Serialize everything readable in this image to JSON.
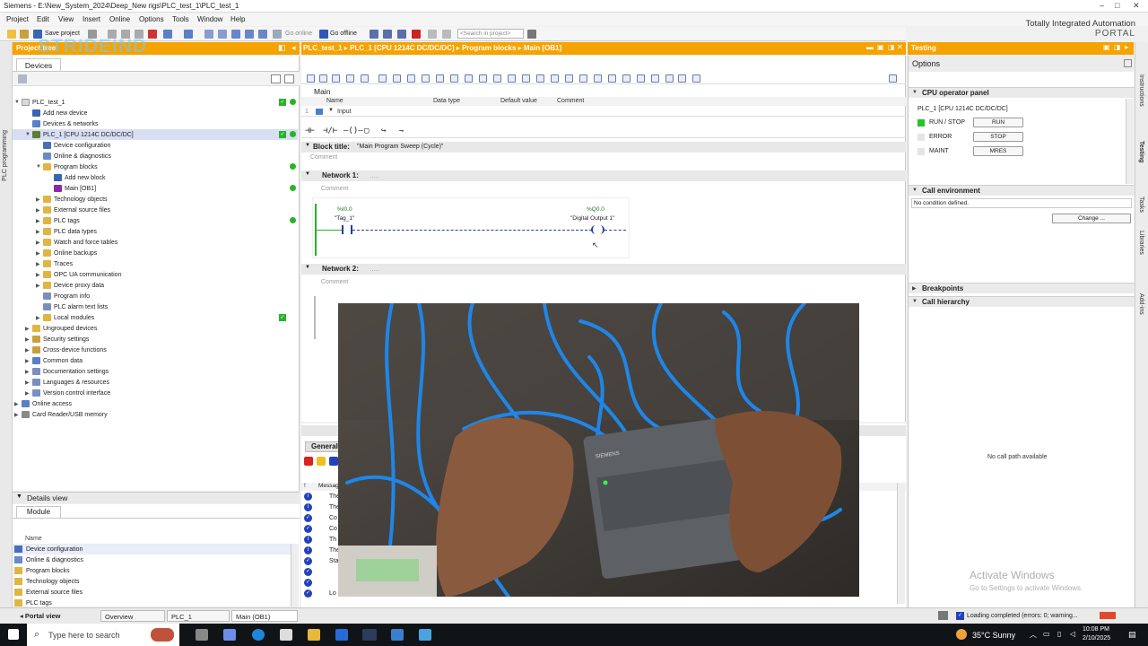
{
  "window": {
    "title": "Siemens - E:\\New_System_2024\\Deep_New rigs\\PLC_test_1\\PLC_test_1",
    "brand_line1": "Totally Integrated Automation",
    "brand_line2": "PORTAL"
  },
  "menu": [
    "Project",
    "Edit",
    "View",
    "Insert",
    "Online",
    "Options",
    "Tools",
    "Window",
    "Help"
  ],
  "toolbar": {
    "save_project": "Save project",
    "go_online": "Go online",
    "go_offline": "Go offline",
    "search_placeholder": "<Search in project>"
  },
  "project_tree": {
    "header": "Project tree",
    "watermark": "STRIDEIND",
    "side_label": "PLC programming",
    "tab": "Devices",
    "items": [
      {
        "label": "PLC_test_1"
      },
      {
        "label": "Add new device"
      },
      {
        "label": "Devices & networks"
      },
      {
        "label": "PLC_1 [CPU 1214C DC/DC/DC]"
      },
      {
        "label": "Device configuration"
      },
      {
        "label": "Online & diagnostics"
      },
      {
        "label": "Program blocks"
      },
      {
        "label": "Add new block"
      },
      {
        "label": "Main [OB1]"
      },
      {
        "label": "Technology objects"
      },
      {
        "label": "External source files"
      },
      {
        "label": "PLC tags"
      },
      {
        "label": "PLC data types"
      },
      {
        "label": "Watch and force tables"
      },
      {
        "label": "Online backups"
      },
      {
        "label": "Traces"
      },
      {
        "label": "OPC UA communication"
      },
      {
        "label": "Device proxy data"
      },
      {
        "label": "Program info"
      },
      {
        "label": "PLC alarm text lists"
      },
      {
        "label": "Local modules"
      },
      {
        "label": "Ungrouped devices"
      },
      {
        "label": "Security settings"
      },
      {
        "label": "Cross-device functions"
      },
      {
        "label": "Common data"
      },
      {
        "label": "Documentation settings"
      },
      {
        "label": "Languages & resources"
      },
      {
        "label": "Version control interface"
      },
      {
        "label": "Online access"
      },
      {
        "label": "Card Reader/USB memory"
      }
    ]
  },
  "details_view": {
    "header": "Details view",
    "tab": "Module",
    "column": "Name",
    "items": [
      "Device configuration",
      "Online & diagnostics",
      "Program blocks",
      "Technology objects",
      "External source files",
      "PLC tags"
    ]
  },
  "editor": {
    "breadcrumb": "PLC_test_1 ▸ PLC_1 [CPU 1214C DC/DC/DC] ▸ Program blocks ▸ Main [OB1]",
    "block_name": "Main",
    "interface_cols": [
      "Name",
      "Data type",
      "Default value",
      "Comment"
    ],
    "interface_row": "Input",
    "block_title_label": "Block title:",
    "block_title_value": "\"Main Program Sweep (Cycle)\"",
    "comment": "Comment",
    "network1": "Network 1:",
    "network1_dots": ".....",
    "network2": "Network 2:",
    "network2_dots": ".....",
    "contact_addr": "%I0.0",
    "contact_name": "\"Tag_1\"",
    "coil_addr": "%Q0.0",
    "coil_name": "\"Digital Output 1\""
  },
  "messages": {
    "tab": "General",
    "col": "Message",
    "rows": [
      "The",
      "The",
      "Co",
      "Co",
      "Th",
      "The",
      "Sta",
      "",
      "",
      "Lo"
    ]
  },
  "testing": {
    "header": "Testing",
    "options": "Options",
    "cpu_panel": "CPU operator panel",
    "cpu_name": "PLC_1 [CPU 1214C DC/DC/DC]",
    "run_stop": "RUN / STOP",
    "error": "ERROR",
    "maint": "MAINT",
    "btn_run": "RUN",
    "btn_stop": "STOP",
    "btn_mres": "MRES",
    "call_env": "Call environment",
    "no_condition": "No condition defined.",
    "change": "Change ...",
    "breakpoints": "Breakpoints",
    "call_hierarchy": "Call hierarchy",
    "no_call_path": "No call path available",
    "run_lamp_color": "#27c427"
  },
  "right_tabs": [
    "Instructions",
    "Testing",
    "Tasks",
    "Libraries",
    "Add-ins"
  ],
  "portal_bar": {
    "portal_view": "Portal view",
    "tabs": [
      "Overview",
      "PLC_1",
      "Main (OB1)"
    ],
    "status": "Loading completed (errors: 0; warning..."
  },
  "taskbar": {
    "search": "Type here to search",
    "weather": "35°C  Sunny",
    "time": "10:08 PM",
    "date": "2/10/2025"
  },
  "activate": {
    "line1": "Activate Windows",
    "line2": "Go to Settings to activate Windows."
  },
  "video_label": "SIEMENS"
}
